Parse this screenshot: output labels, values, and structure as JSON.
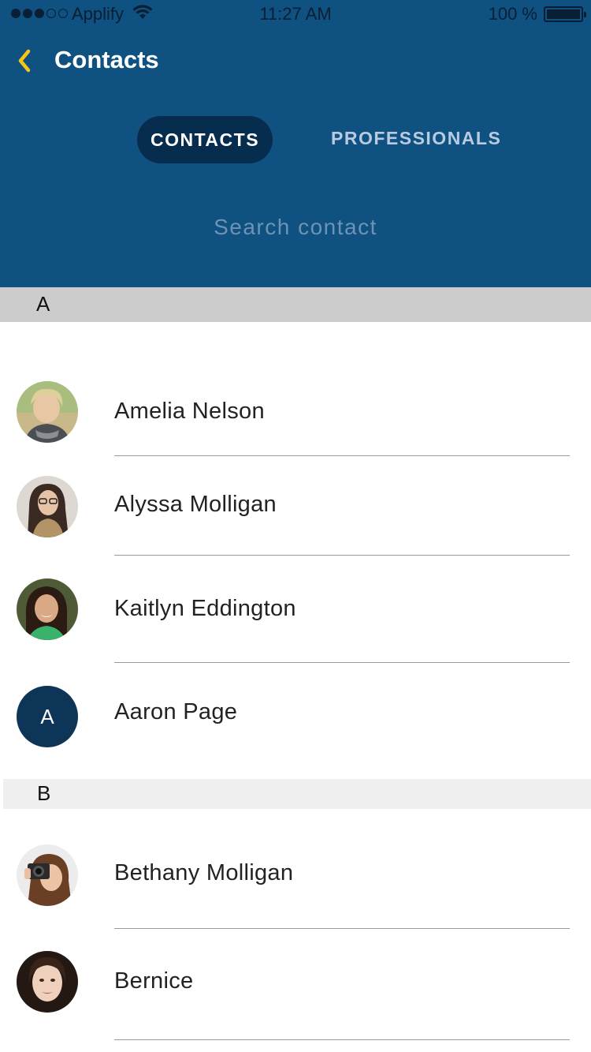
{
  "status_bar": {
    "carrier": "Applify",
    "time": "11:27 AM",
    "battery_pct": "100 %"
  },
  "nav": {
    "title": "Contacts",
    "back_icon": "chevron-left-icon"
  },
  "tabs": [
    {
      "label": "CONTACTS",
      "active": true
    },
    {
      "label": "PROFESSIONALS",
      "active": false
    }
  ],
  "search": {
    "placeholder": "Search contact",
    "value": ""
  },
  "sections": [
    {
      "letter": "A",
      "contacts": [
        {
          "name": "Amelia Nelson",
          "avatar": "photo"
        },
        {
          "name": "Alyssa Molligan",
          "avatar": "photo"
        },
        {
          "name": "Kaitlyn Eddington",
          "avatar": "photo"
        },
        {
          "name": "Aaron Page",
          "avatar": "initial",
          "initial": "A"
        }
      ]
    },
    {
      "letter": "B",
      "contacts": [
        {
          "name": "Bethany Molligan",
          "avatar": "photo"
        },
        {
          "name": "Bernice",
          "avatar": "photo"
        }
      ]
    }
  ],
  "colors": {
    "header_bg": "#0f5181",
    "tab_active_bg": "#062c4e",
    "accent_back": "#f5c518",
    "initial_avatar_bg": "#0c3558"
  }
}
